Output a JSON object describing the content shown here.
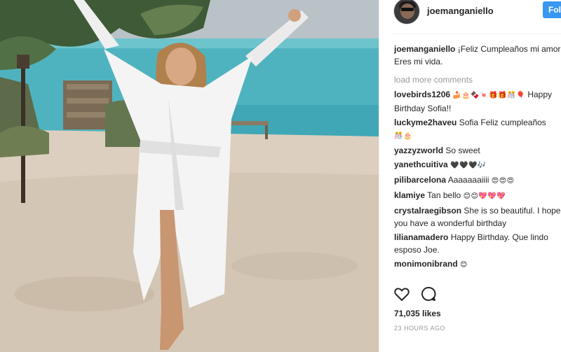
{
  "post": {
    "username": "joemanganiello",
    "follow_label": "Follo",
    "caption_user": "joemanganiello",
    "caption_line1": "¡Feliz Cumpleaños mi amor!",
    "caption_line2": "Eres mi vida.",
    "load_more": "load more comments",
    "likes": "71,035 likes",
    "timestamp": "23 HOURS AGO"
  },
  "comments": [
    {
      "user": "lovebirds1206",
      "emoji": "🍰🎂🍫🍬🎁🎁🎊🎈",
      "text": "Happy Birthday Sofia!!"
    },
    {
      "user": "luckyme2haveu",
      "text": "Sofia Feliz cumpleaños",
      "emoji": "🎊🎂"
    },
    {
      "user": "yazzyzworld",
      "text": "So sweet"
    },
    {
      "user": "yanethcuitiva",
      "emoji": "🖤🖤🖤🎶",
      "text": ""
    },
    {
      "user": "pilibarcelona",
      "text": "Aaaaaaaiiii",
      "emoji": "😍😍😍"
    },
    {
      "user": "klamiye",
      "text": "Tan bello",
      "emoji": "😊😊💖💖💖"
    },
    {
      "user": "crystalraegibson",
      "text": "She is so beautiful. I hope you have a wonderful birthday"
    },
    {
      "user": "lilianamadero",
      "text": "Happy Birthday. Que lindo esposo Joe."
    },
    {
      "user": "monimonibrand",
      "emoji": "😊",
      "text": ""
    }
  ],
  "icons": {
    "heart": "heart-icon",
    "comment": "comment-icon",
    "avatar": "profile-avatar"
  },
  "colors": {
    "follow_button": "#3897f0",
    "muted_text": "#999999",
    "primary_text": "#262626"
  }
}
